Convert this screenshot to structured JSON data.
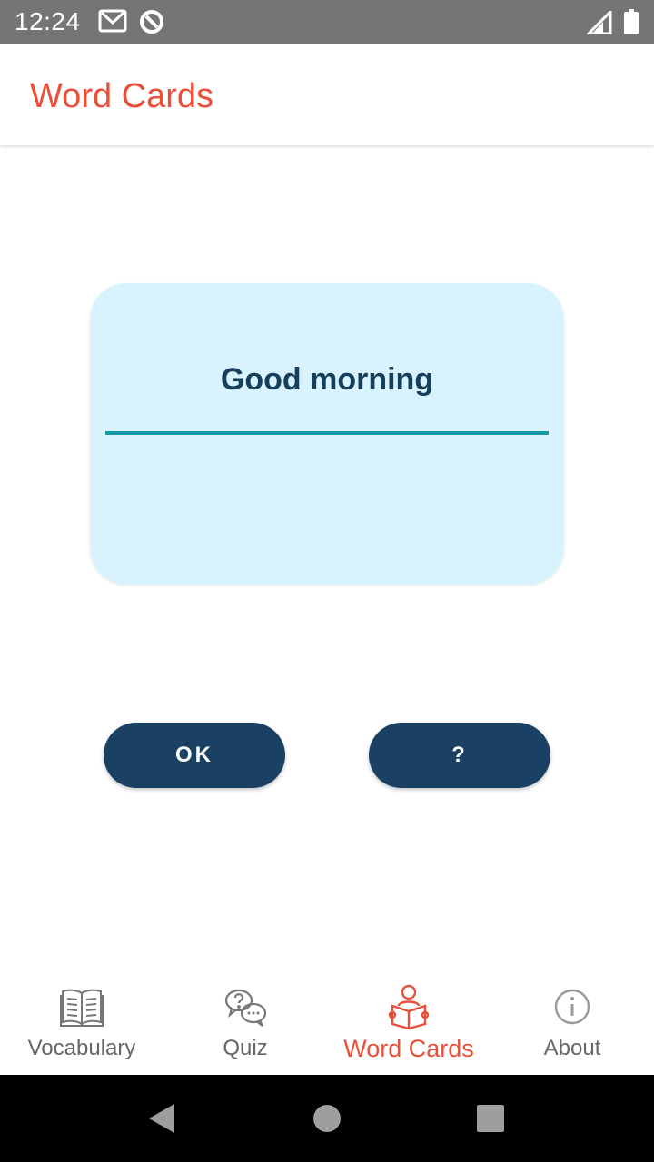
{
  "status_bar": {
    "time": "12:24",
    "icons": [
      "gmail-icon",
      "data-saver-icon",
      "signal-icon",
      "battery-icon"
    ]
  },
  "app_bar": {
    "title": "Word Cards"
  },
  "card": {
    "word": "Good morning",
    "answer_value": ""
  },
  "buttons": {
    "ok_label": "OK",
    "hint_label": "?"
  },
  "bottom_nav": {
    "items": [
      {
        "label": "Vocabulary",
        "icon": "book-icon",
        "active": false
      },
      {
        "label": "Quiz",
        "icon": "chat-question-icon",
        "active": false
      },
      {
        "label": "Word Cards",
        "icon": "reader-icon",
        "active": true
      },
      {
        "label": "About",
        "icon": "info-icon",
        "active": false
      }
    ]
  },
  "system_nav": {
    "icons": [
      "back-icon",
      "home-icon",
      "recents-icon"
    ]
  },
  "colors": {
    "accent": "#e8503a",
    "card_background": "#d8f3fd",
    "card_text": "#163f5c",
    "underline": "#1599a8",
    "button": "#1a4063",
    "inactive_nav": "#666666"
  }
}
